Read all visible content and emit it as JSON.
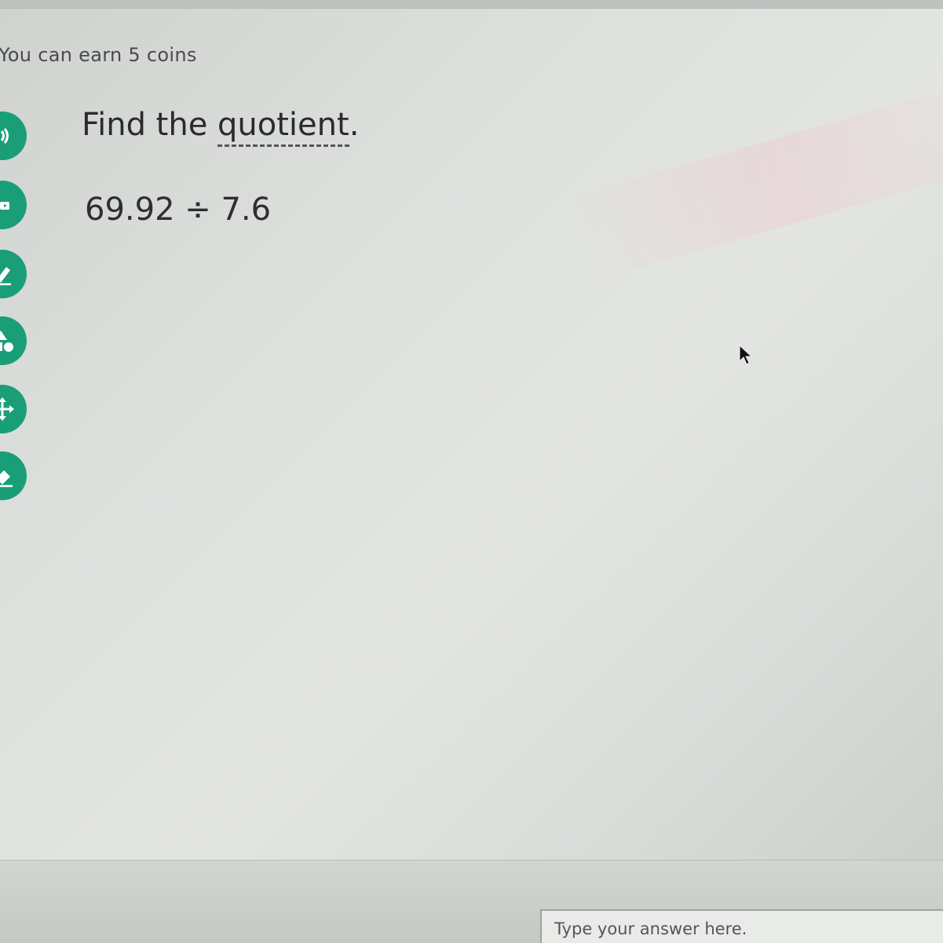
{
  "header": {
    "coins_text": "You can earn 5 coins"
  },
  "question": {
    "prefix": "Find the ",
    "vocab_word": "quotient",
    "suffix": ".",
    "expression": "69.92 ÷ 7.6"
  },
  "answer": {
    "placeholder": "Type your answer here."
  },
  "sidebar": {
    "tools": [
      {
        "name": "audio-icon"
      },
      {
        "name": "read-aloud-icon"
      },
      {
        "name": "pencil-icon"
      },
      {
        "name": "shapes-icon"
      },
      {
        "name": "move-icon"
      },
      {
        "name": "eraser-icon"
      }
    ]
  },
  "colors": {
    "accent": "#1a9e78",
    "text": "#2b2b2b"
  }
}
